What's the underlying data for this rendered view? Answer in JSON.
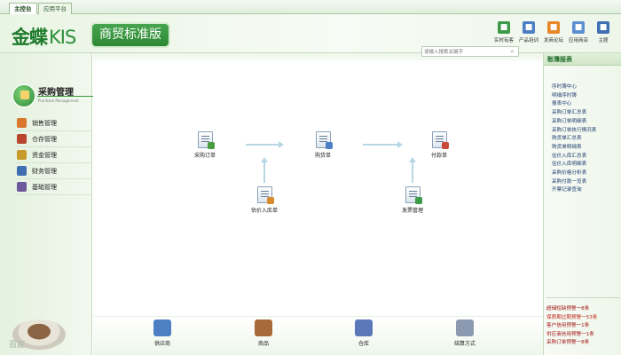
{
  "tabs": [
    {
      "label": "主控台",
      "active": true
    },
    {
      "label": "应用平台",
      "active": false
    }
  ],
  "header": {
    "brand": "金蝶",
    "product": "KIS",
    "edition": "商贸标准版",
    "colors": {
      "brand_green": "#1e7b2c",
      "badge_green": "#2d8834"
    }
  },
  "toolbar": [
    {
      "label": "实时有客",
      "icon": "customer-icon",
      "color": "#3d9a48"
    },
    {
      "label": "产品培训",
      "icon": "training-icon",
      "color": "#4d7fc4"
    },
    {
      "label": "发商论坛",
      "icon": "forum-icon",
      "color": "#e8862a"
    },
    {
      "label": "应用商店",
      "icon": "store-icon",
      "color": "#5a8fd0"
    },
    {
      "label": "主题",
      "icon": "theme-icon",
      "color": "#3f6fb2"
    }
  ],
  "sidebar": {
    "module": {
      "title": "采购管理",
      "subtitle": "Purchase Management",
      "icon": "purchase-module-icon"
    },
    "items": [
      {
        "label": "销售管理",
        "icon": "sales-icon",
        "color": "#d9782c"
      },
      {
        "label": "仓存管理",
        "icon": "inventory-icon",
        "color": "#b8472e"
      },
      {
        "label": "资金管理",
        "icon": "funds-icon",
        "color": "#c99a2c"
      },
      {
        "label": "财务管理",
        "icon": "finance-icon",
        "color": "#3f6fb2"
      },
      {
        "label": "基础管理",
        "icon": "basic-icon",
        "color": "#6d5a9c"
      }
    ],
    "watermark": "百度"
  },
  "search": {
    "placeholder": "请输入搜索关键字"
  },
  "flow": {
    "nodes": [
      {
        "id": "order",
        "label": "采购订单",
        "icon": "purchase-order-icon",
        "accent": "#4a9c3f"
      },
      {
        "id": "receipt",
        "label": "购货单",
        "icon": "receipt-icon",
        "accent": "#4a7fc4"
      },
      {
        "id": "payment",
        "label": "付款单",
        "icon": "payment-icon",
        "accent": "#c94a3a"
      },
      {
        "id": "inbound",
        "label": "估价入库单",
        "icon": "estimated-inbound-icon",
        "accent": "#d58a2c"
      },
      {
        "id": "invoice",
        "label": "发票管理",
        "icon": "invoice-icon",
        "accent": "#3d9a48"
      }
    ]
  },
  "bottom": [
    {
      "label": "供应商",
      "icon": "supplier-icon",
      "color": "#4d7fc4"
    },
    {
      "label": "商品",
      "icon": "goods-icon",
      "color": "#a76b3a"
    },
    {
      "label": "仓库",
      "icon": "warehouse-icon",
      "color": "#5b78b8"
    },
    {
      "label": "结算方式",
      "icon": "settlement-icon",
      "color": "#8b9ab0"
    }
  ],
  "right_panel": {
    "title": "账簿报表",
    "reports": [
      "序时簿中心",
      "明细序时簿",
      "报表中心",
      "采购订单汇总表",
      "采购订单明细表",
      "采购订单执行情况表",
      "购货单汇总表",
      "购货单明细表",
      "估价入库汇总表",
      "估价入库明细表",
      "采购价格分析表",
      "采购付款一览表",
      "开票记录查询"
    ],
    "alerts": [
      "超储短缺预警一8条",
      "保质期过期预警一53条",
      "客户信用预警一1条",
      "供应商信用预警一1条",
      "采购订单预警一8条"
    ]
  }
}
